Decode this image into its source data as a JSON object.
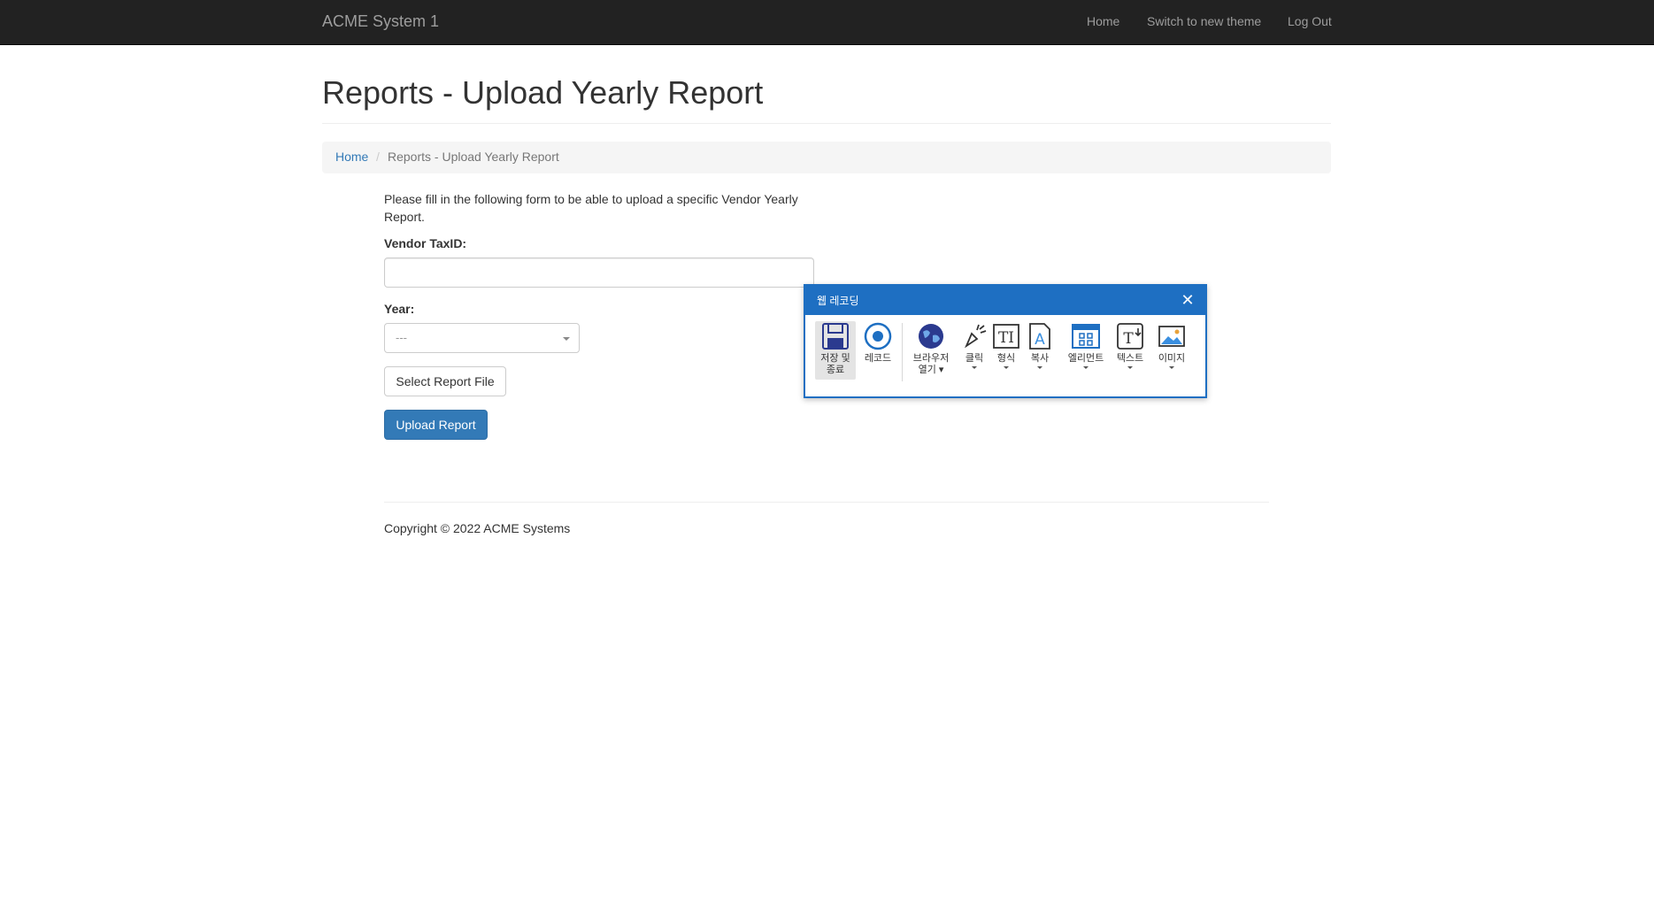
{
  "navbar": {
    "brand": "ACME System 1",
    "links": [
      "Home",
      "Switch to new theme",
      "Log Out"
    ]
  },
  "page": {
    "title": "Reports - Upload Yearly Report"
  },
  "breadcrumb": {
    "home": "Home",
    "separator": "/",
    "current": "Reports - Upload Yearly Report"
  },
  "form": {
    "intro": "Please fill in the following form to be able to upload a specific Vendor Yearly Report.",
    "vendor_label": "Vendor TaxID:",
    "vendor_value": "",
    "year_label": "Year:",
    "year_selected": "---",
    "select_file_label": "Select Report File",
    "upload_label": "Upload Report"
  },
  "footer": {
    "copyright": "Copyright © 2022 ACME Systems"
  },
  "recorder": {
    "title": "웹 레코딩",
    "close_icon": "close-icon",
    "tools": [
      {
        "label_line1": "저장 및",
        "label_line2": "종료",
        "icon": "save-icon"
      },
      {
        "label_line1": "레코드",
        "icon": "record-icon"
      },
      {
        "label_line1": "브라우저",
        "label_line2": "열기",
        "icon": "globe-icon"
      },
      {
        "label_line1": "클릭",
        "icon": "click-icon"
      },
      {
        "label_line1": "형식",
        "icon": "type-icon"
      },
      {
        "label_line1": "복사",
        "icon": "copy-icon"
      },
      {
        "label_line1": "엘리먼트",
        "icon": "element-icon"
      },
      {
        "label_line1": "텍스트",
        "icon": "text-icon"
      },
      {
        "label_line1": "이미지",
        "icon": "image-icon"
      }
    ]
  },
  "colors": {
    "navbar_bg": "#222222",
    "link": "#337ab7",
    "primary_button": "#337ab7",
    "recorder_accent": "#1e6fc2"
  }
}
